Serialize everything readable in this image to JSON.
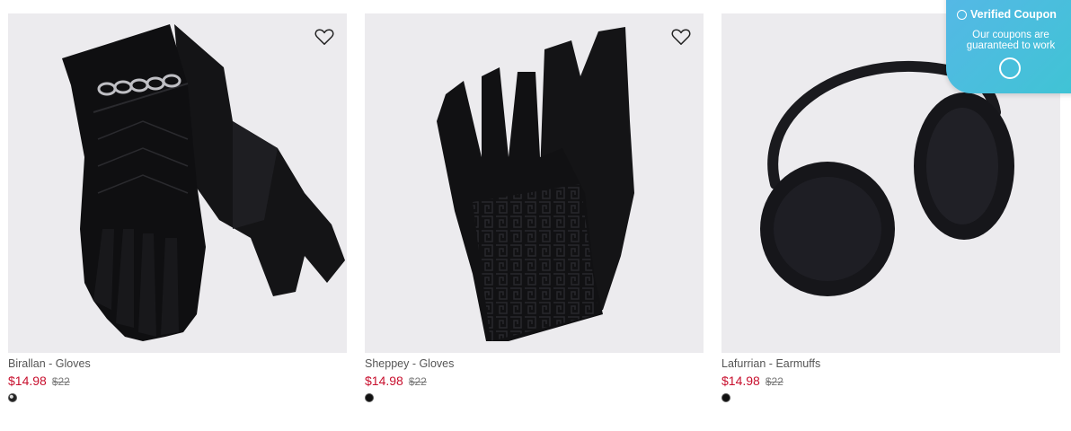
{
  "products": [
    {
      "name": "Birallan - Gloves",
      "sale_price": "$14.98",
      "original_price": "$22",
      "image": "black-chain-gloves"
    },
    {
      "name": "Sheppey - Gloves",
      "sale_price": "$14.98",
      "original_price": "$22",
      "image": "black-embossed-gloves"
    },
    {
      "name": "Lafurrian - Earmuffs",
      "sale_price": "$14.98",
      "original_price": "$22",
      "image": "black-fur-earmuffs"
    }
  ],
  "coupon_badge": {
    "title": "Verified Coupon",
    "subtitle": "Our coupons are guaranteed to work"
  },
  "icons": {
    "favorite": "heart-outline-icon",
    "coupon": "check-circle-icon"
  },
  "colors": {
    "sale": "#c8102e",
    "card_bg": "#ecebee",
    "coupon": "#4cbde0"
  }
}
